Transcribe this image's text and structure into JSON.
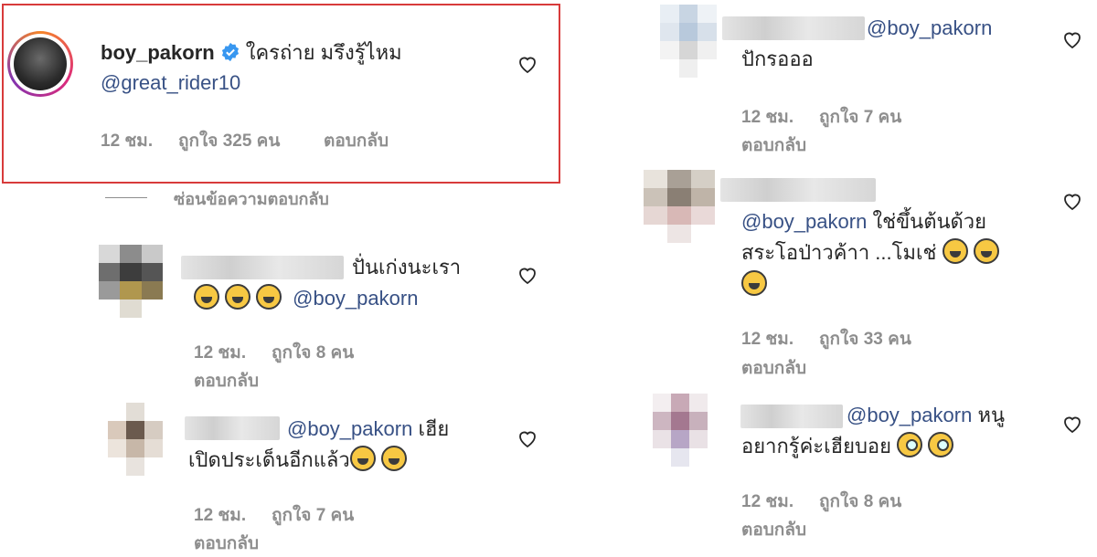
{
  "main_comment": {
    "username": "boy_pakorn",
    "text": "ใครถ่าย มรึงรู้ไหม",
    "mention": "@great_rider10",
    "time": "12 ชม.",
    "likes": "ถูกใจ 325 คน",
    "reply": "ตอบกลับ"
  },
  "hide_replies": "ซ่อนข้อความตอบกลับ",
  "replies_left": [
    {
      "text1": "ปั่นเก่งนะเรา",
      "mention": "@boy_pakorn",
      "time": "12 ชม.",
      "likes": "ถูกใจ 8 คน",
      "reply": "ตอบกลับ"
    },
    {
      "mention": "@boy_pakorn",
      "text1": "เฮีย",
      "text2": "เปิดประเด็นอีกแล้ว",
      "time": "12 ชม.",
      "likes": "ถูกใจ 7 คน",
      "reply": "ตอบกลับ"
    }
  ],
  "replies_right": [
    {
      "mention": "@boy_pakorn",
      "text1": "ปักรอออ",
      "time": "12 ชม.",
      "likes": "ถูกใจ 7 คน",
      "reply": "ตอบกลับ"
    },
    {
      "mention": "@boy_pakorn",
      "text1": "ใช่ขึ้นต้นด้วย",
      "text2": "สระโอป่าวค้าา ...โมเช่",
      "time": "12 ชม.",
      "likes": "ถูกใจ 33 คน",
      "reply": "ตอบกลับ"
    },
    {
      "mention": "@boy_pakorn",
      "text1": "หนู",
      "text2": "อยากรู้ค่ะเฮียบอย",
      "time": "12 ชม.",
      "likes": "ถูกใจ 8 คน",
      "reply": "ตอบกลับ"
    }
  ],
  "icons": {
    "like": "heart-icon",
    "verified": "verified-badge-icon",
    "emoji": "laughing-emoji-icon"
  },
  "colors": {
    "mention": "#385185",
    "meta": "#8e8e8e",
    "highlight": "#d83b3b",
    "verified": "#3897f0"
  }
}
